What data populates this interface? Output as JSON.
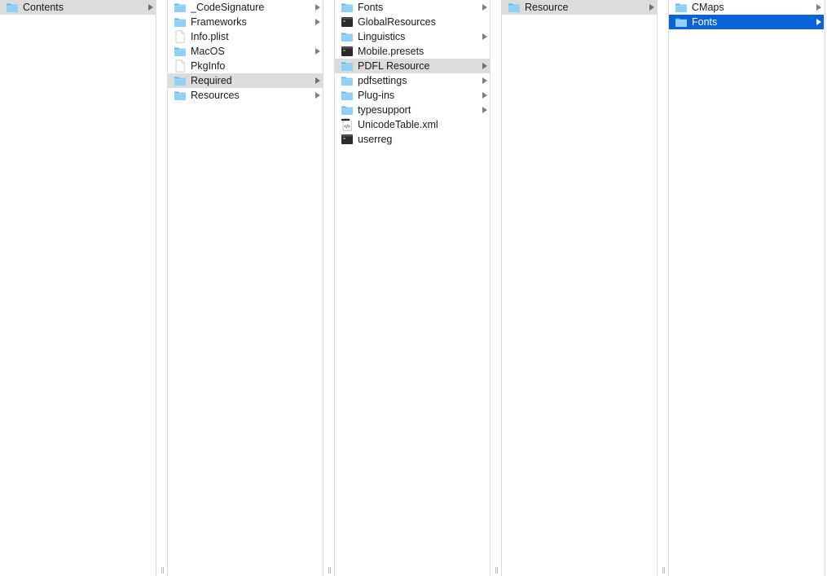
{
  "columns": [
    {
      "items": [
        {
          "label": "Contents",
          "icon": "folder-icon",
          "chevron": true,
          "state": "selected-inactive"
        }
      ]
    },
    {
      "items": [
        {
          "label": "_CodeSignature",
          "icon": "folder-icon",
          "chevron": true,
          "state": ""
        },
        {
          "label": "Frameworks",
          "icon": "folder-icon",
          "chevron": true,
          "state": ""
        },
        {
          "label": "Info.plist",
          "icon": "document-icon",
          "chevron": false,
          "state": ""
        },
        {
          "label": "MacOS",
          "icon": "folder-icon",
          "chevron": true,
          "state": ""
        },
        {
          "label": "PkgInfo",
          "icon": "document-icon",
          "chevron": false,
          "state": ""
        },
        {
          "label": "Required",
          "icon": "folder-icon",
          "chevron": true,
          "state": "selected-inactive"
        },
        {
          "label": "Resources",
          "icon": "folder-icon",
          "chevron": true,
          "state": ""
        }
      ]
    },
    {
      "items": [
        {
          "label": "Fonts",
          "icon": "folder-icon",
          "chevron": true,
          "state": ""
        },
        {
          "label": "GlobalResources",
          "icon": "terminal-file-icon",
          "chevron": false,
          "state": ""
        },
        {
          "label": "Linguistics",
          "icon": "folder-icon",
          "chevron": true,
          "state": ""
        },
        {
          "label": "Mobile.presets",
          "icon": "terminal-file-icon",
          "chevron": false,
          "state": ""
        },
        {
          "label": "PDFL Resource",
          "icon": "folder-icon",
          "chevron": true,
          "state": "selected-inactive"
        },
        {
          "label": "pdfsettings",
          "icon": "folder-icon",
          "chevron": true,
          "state": ""
        },
        {
          "label": "Plug-ins",
          "icon": "folder-icon",
          "chevron": true,
          "state": ""
        },
        {
          "label": "typesupport",
          "icon": "folder-icon",
          "chevron": true,
          "state": ""
        },
        {
          "label": "UnicodeTable.xml",
          "icon": "xml-file-icon",
          "chevron": false,
          "state": ""
        },
        {
          "label": "userreg",
          "icon": "terminal-file-icon",
          "chevron": false,
          "state": ""
        }
      ]
    },
    {
      "items": [
        {
          "label": "Resource",
          "icon": "folder-icon",
          "chevron": true,
          "state": "selected-inactive"
        }
      ]
    },
    {
      "items": [
        {
          "label": "CMaps",
          "icon": "folder-icon",
          "chevron": true,
          "state": ""
        },
        {
          "label": "Fonts",
          "icon": "folder-icon",
          "chevron": true,
          "state": "selected-active"
        }
      ]
    }
  ],
  "colors": {
    "selection_active": "#0a63d6",
    "selection_inactive": "#dcdcdc",
    "folder": "#6dc3f5",
    "divider": "#dcdcdc"
  },
  "resize_handle_glyph": "||"
}
